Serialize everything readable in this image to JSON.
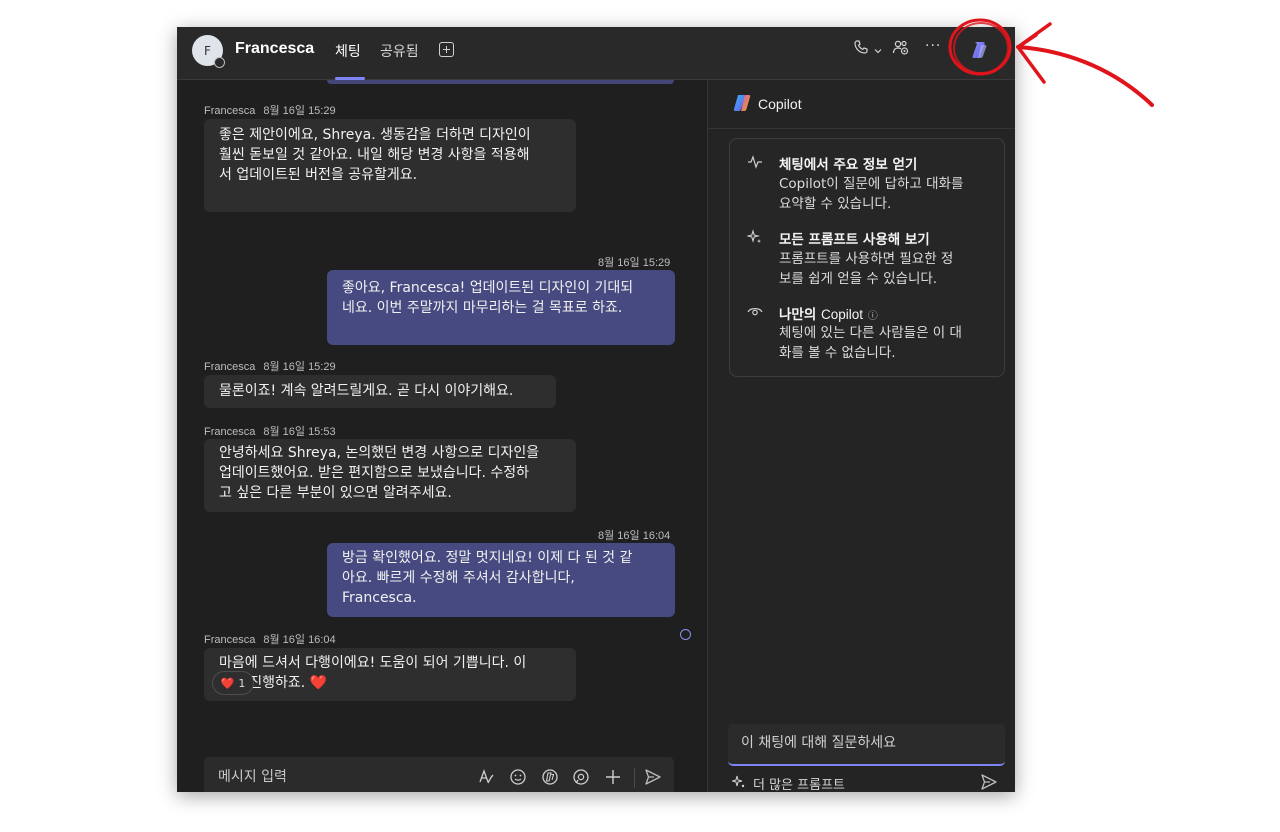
{
  "header": {
    "avatar_initial": "F",
    "contact_name": "Francesca",
    "tabs": [
      {
        "label": "체팅",
        "active": true
      },
      {
        "label": "공유됨",
        "active": false
      }
    ],
    "icons": [
      "phone-icon",
      "chevron-down-icon",
      "people-settings-icon",
      "more-icon",
      "copilot-icon"
    ],
    "more_label": "···"
  },
  "messages": [
    {
      "direction": "in",
      "sender": "Francesca",
      "time": "8월 16일 15:29",
      "lines": [
        "좋은 제안이에요, Shreya. 생동감을 더하면 디자인이",
        "훨씬 돋보일 것 같아요. 내일 해당 변경 사항을 적용해",
        "서 업데이트된 버전을 공유할게요."
      ]
    },
    {
      "direction": "out",
      "time": "8월 16일 15:29",
      "lines": [
        "좋아요, Francesca! 업데이트된 디자인이 기대되",
        "네요. 이번 주말까지 마무리하는 걸 목표로 하죠."
      ]
    },
    {
      "direction": "in",
      "sender": "Francesca",
      "time": "8월 16일 15:29",
      "lines": [
        "물론이죠! 계속 알려드릴게요. 곧 다시 이야기해요."
      ]
    },
    {
      "direction": "in",
      "sender": "Francesca",
      "time": "8월 16일 15:53",
      "lines": [
        "안녕하세요 Shreya, 논의했던 변경 사항으로 디자인을",
        "업데이트했어요. 받은 편지함으로 보냈습니다. 수정하",
        "고 싶은 다른 부분이 있으면 알려주세요."
      ]
    },
    {
      "direction": "out",
      "time": "8월 16일 16:04",
      "lines": [
        "방금 확인했어요. 정말 멋지네요! 이제 다 된 것 같",
        "아요. 빠르게 수정해 주셔서 감사합니다,",
        "Francesca."
      ]
    },
    {
      "direction": "in",
      "sender": "Francesca",
      "time": "8월 16일 16:04",
      "lines": [
        "마음에 드셔서 다행이에요! 도움이 되어 기쁩니다. 이",
        "대로 진행하죠. ❤️"
      ]
    }
  ],
  "reaction": {
    "emoji": "❤️",
    "count": "1"
  },
  "composer": {
    "placeholder": "메시지 입력",
    "icons": [
      "format-icon",
      "emoji-icon",
      "copilot-small-icon",
      "loop-icon",
      "add-icon",
      "send-icon"
    ]
  },
  "copilot_panel": {
    "title": "Copilot",
    "features": [
      {
        "icon": "pulse-icon",
        "title": "체팅에서 주요 정보 얻기",
        "desc_lines": [
          "Copilot이 질문에 답하고 대화를",
          "요약할 수 있습니다."
        ]
      },
      {
        "icon": "sparkle-icon",
        "title": "모든 프롬프트 사용해 보기",
        "desc_lines": [
          "프롬프트를 사용하면 필요한 정",
          "보를 쉽게 얻을 수 있습니다."
        ]
      },
      {
        "icon": "eye-icon",
        "title_bold": "나만의",
        "title_light": "Copilot",
        "info_icon": "ⓘ",
        "desc_lines": [
          "체팅에 있는 다른 사람들은 이 대",
          "화를 볼 수 없습니다."
        ]
      }
    ],
    "ask_placeholder": "이 채팅에 대해 질문하세요",
    "more_prompts": "더 많은 프롬프트"
  },
  "colors": {
    "window_bg": "#1f1f1f",
    "outgoing_bubble": "#474a80",
    "incoming_bubble": "#2e2e2e",
    "accent": "#7f85f5",
    "annotation": "#e0151b"
  }
}
